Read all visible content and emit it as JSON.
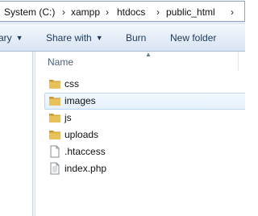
{
  "address_bar": {
    "crumbs": [
      "System (C:)",
      "xampp",
      "htdocs",
      "public_html"
    ],
    "separator": "›"
  },
  "toolbar": {
    "organize_partial": "ary",
    "share_with_label": "Share with",
    "burn_label": "Burn",
    "new_folder_label": "New folder",
    "dropdown_glyph": "▼"
  },
  "file_list": {
    "column_name": "Name",
    "sort_glyph": "▲",
    "items": [
      {
        "name": "css",
        "type": "folder",
        "selected": false
      },
      {
        "name": "images",
        "type": "folder",
        "selected": true
      },
      {
        "name": "js",
        "type": "folder",
        "selected": false
      },
      {
        "name": "uploads",
        "type": "folder",
        "selected": false
      },
      {
        "name": ".htaccess",
        "type": "file",
        "selected": false
      },
      {
        "name": "index.php",
        "type": "file",
        "selected": false
      }
    ]
  },
  "colors": {
    "folder": "#e8c15b",
    "folder_dark": "#c99a2e",
    "selection_border": "#b9d6f5"
  }
}
